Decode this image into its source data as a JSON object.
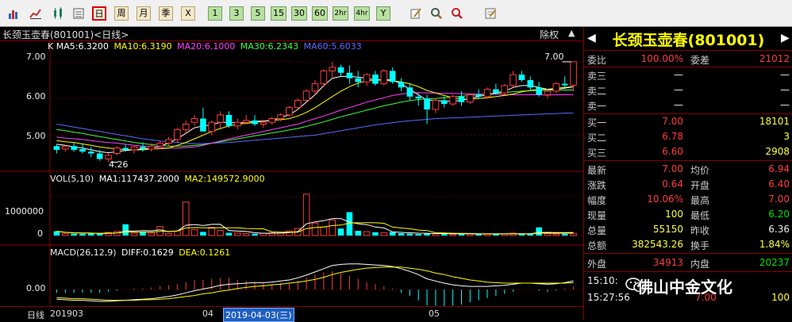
{
  "toolbar": {
    "icons": [
      "bar-chart-icon",
      "line-chart-icon",
      "kline-icon",
      "candlestick-icon",
      "quote-list-icon"
    ],
    "periods": [
      "日",
      "周",
      "月",
      "季",
      "X"
    ],
    "minutes": [
      "1",
      "3",
      "5",
      "15",
      "30",
      "60",
      "2hr",
      "4hr",
      "Y"
    ],
    "tools": [
      "edit-icon",
      "search-icon",
      "search-red-icon",
      "notes-icon"
    ]
  },
  "title": {
    "stock": "长颈玉壶春(801001)<日线>",
    "fuquan": "除权"
  },
  "legends": {
    "k_prefix": "K",
    "ma5": "MA5:6.3200",
    "ma10": "MA10:6.3190",
    "ma20": "MA20:6.1000",
    "ma30": "MA30:6.2343",
    "ma60": "MA60:5.6033",
    "vol": "VOL(5,10)",
    "vol_ma1": "MA1:117437.2000",
    "vol_ma2": "MA2:149572.9000",
    "macd": "MACD(26,12,9)",
    "diff": "DIFF:0.1629",
    "dea": "DEA:0.1261"
  },
  "axis": {
    "price_ticks": [
      "7.00",
      "6.00",
      "5.00"
    ],
    "vol_ticks": [
      "1000000",
      "0"
    ],
    "macd_ticks": [
      "0.00"
    ],
    "high_label": "7.00",
    "low_label": "4.26"
  },
  "date_bar": {
    "label": "日线",
    "start": "201903",
    "m04": "04",
    "selected": "2019-04-03(三)",
    "m05": "05"
  },
  "panel": {
    "title": "长颈玉壶春(801001)",
    "weibi_label": "委比",
    "weibi": "100.00%",
    "weicha_label": "委差",
    "weicha": "21012",
    "sell": [
      {
        "label": "卖三",
        "price": "—",
        "vol": "—"
      },
      {
        "label": "卖二",
        "price": "—",
        "vol": "—"
      },
      {
        "label": "卖一",
        "price": "—",
        "vol": "—"
      }
    ],
    "buy": [
      {
        "label": "买一",
        "price": "7.00",
        "vol": "18101"
      },
      {
        "label": "买二",
        "price": "6.78",
        "vol": "3"
      },
      {
        "label": "买三",
        "price": "6.60",
        "vol": "2908"
      }
    ],
    "stats": [
      {
        "l1": "最新",
        "v1": "7.00",
        "l2": "均价",
        "v2": "6.94"
      },
      {
        "l1": "涨跌",
        "v1": "0.64",
        "l2": "开盘",
        "v2": "6.40"
      },
      {
        "l1": "幅度",
        "v1": "10.06%",
        "l2": "最高",
        "v2": "7.00"
      },
      {
        "l1": "现量",
        "v1": "100",
        "l2": "最低",
        "v2": "6.20"
      },
      {
        "l1": "总量",
        "v1": "55150",
        "l2": "昨收",
        "v2": "6.36"
      },
      {
        "l1": "总额",
        "v1": "382543.26",
        "l2": "换手",
        "v2": "1.84%"
      }
    ],
    "waipan_label": "外盘",
    "waipan": "34913",
    "neipan_label": "内盘",
    "neipan": "20237",
    "ticks": [
      {
        "time": "15:10:",
        "price": "",
        "vol": ""
      },
      {
        "time": "15:27:56",
        "price": "7.00",
        "vol": "100"
      }
    ]
  },
  "watermark": "佛山中金文化",
  "colors": {
    "up": "#ff3c3c",
    "down": "#00ffff",
    "ma5": "#ffffff",
    "ma10": "#ffff00",
    "ma20": "#ff40ff",
    "ma30": "#40ff40",
    "ma60": "#5a6aff"
  },
  "chart_data": {
    "type": "candlestick",
    "ohlc": [
      [
        4.7,
        4.75,
        4.5,
        4.6
      ],
      [
        4.62,
        4.72,
        4.55,
        4.7
      ],
      [
        4.7,
        4.8,
        4.55,
        4.6
      ],
      [
        4.62,
        4.78,
        4.5,
        4.55
      ],
      [
        4.55,
        4.68,
        4.4,
        4.5
      ],
      [
        4.5,
        4.6,
        4.3,
        4.35
      ],
      [
        4.35,
        4.5,
        4.26,
        4.45
      ],
      [
        4.5,
        4.7,
        4.45,
        4.65
      ],
      [
        4.65,
        4.75,
        4.55,
        4.6
      ],
      [
        4.6,
        4.72,
        4.5,
        4.68
      ],
      [
        4.68,
        4.8,
        4.55,
        4.62
      ],
      [
        4.62,
        4.78,
        4.55,
        4.7
      ],
      [
        4.7,
        4.85,
        4.62,
        4.78
      ],
      [
        4.78,
        4.95,
        4.7,
        4.88
      ],
      [
        4.88,
        5.2,
        4.8,
        5.15
      ],
      [
        5.15,
        5.4,
        5.05,
        5.3
      ],
      [
        5.35,
        5.55,
        5.25,
        5.45
      ],
      [
        5.45,
        5.75,
        5.4,
        5.1
      ],
      [
        5.1,
        5.4,
        5.0,
        5.35
      ],
      [
        5.35,
        5.65,
        5.2,
        5.55
      ],
      [
        5.55,
        5.65,
        5.2,
        5.25
      ],
      [
        5.25,
        5.45,
        5.15,
        5.35
      ],
      [
        5.35,
        5.55,
        5.3,
        5.4
      ],
      [
        5.4,
        5.55,
        5.25,
        5.3
      ],
      [
        5.3,
        5.42,
        5.2,
        5.35
      ],
      [
        5.35,
        5.5,
        5.28,
        5.45
      ],
      [
        5.45,
        5.6,
        5.38,
        5.55
      ],
      [
        5.55,
        5.8,
        5.5,
        5.75
      ],
      [
        5.75,
        6.0,
        5.7,
        5.95
      ],
      [
        5.95,
        6.25,
        5.9,
        6.2
      ],
      [
        6.2,
        6.5,
        6.1,
        6.4
      ],
      [
        6.4,
        6.8,
        6.3,
        6.75
      ],
      [
        6.75,
        7.0,
        6.55,
        6.85
      ],
      [
        6.85,
        6.92,
        6.6,
        6.7
      ],
      [
        6.7,
        6.9,
        6.4,
        6.55
      ],
      [
        6.55,
        6.75,
        6.3,
        6.45
      ],
      [
        6.45,
        6.7,
        6.35,
        6.65
      ],
      [
        6.65,
        6.75,
        6.35,
        6.4
      ],
      [
        6.4,
        6.8,
        6.35,
        6.75
      ],
      [
        6.75,
        6.85,
        6.4,
        6.45
      ],
      [
        6.45,
        6.55,
        6.2,
        6.3
      ],
      [
        6.3,
        6.4,
        5.95,
        6.05
      ],
      [
        6.05,
        6.15,
        5.8,
        6.0
      ],
      [
        6.0,
        6.1,
        5.3,
        5.7
      ],
      [
        5.7,
        6.0,
        5.6,
        5.95
      ],
      [
        5.95,
        6.05,
        5.75,
        5.85
      ],
      [
        5.85,
        6.1,
        5.8,
        6.05
      ],
      [
        6.05,
        6.2,
        5.8,
        5.9
      ],
      [
        5.9,
        6.15,
        5.85,
        6.1
      ],
      [
        6.1,
        6.25,
        6.0,
        6.05
      ],
      [
        6.05,
        6.3,
        6.0,
        6.25
      ],
      [
        6.25,
        6.4,
        6.1,
        6.15
      ],
      [
        6.15,
        6.4,
        6.1,
        6.35
      ],
      [
        6.35,
        6.75,
        6.3,
        6.65
      ],
      [
        6.65,
        6.75,
        6.45,
        6.5
      ],
      [
        6.5,
        6.6,
        6.2,
        6.3
      ],
      [
        6.3,
        6.45,
        6.05,
        6.1
      ],
      [
        6.1,
        6.25,
        6.0,
        6.2
      ],
      [
        6.2,
        6.45,
        6.15,
        6.4
      ],
      [
        6.4,
        6.6,
        6.3,
        6.36
      ],
      [
        6.36,
        7.0,
        6.2,
        7.0
      ]
    ],
    "volume": [
      110000,
      55000,
      50000,
      45000,
      60000,
      40000,
      80000,
      105000,
      290000,
      60000,
      100000,
      60000,
      230000,
      55000,
      120000,
      860000,
      150000,
      95000,
      210000,
      130000,
      70000,
      65000,
      50000,
      45000,
      60000,
      70000,
      80000,
      120000,
      180000,
      1060000,
      320000,
      220000,
      400000,
      180000,
      600000,
      120000,
      100000,
      85000,
      70000,
      90000,
      60000,
      50000,
      40000,
      60000,
      45000,
      55000,
      35000,
      50000,
      40000,
      35000,
      45000,
      40000,
      45000,
      60000,
      45000,
      40000,
      210000,
      50000,
      40000,
      45000,
      55150
    ],
    "ma5": [
      4.75,
      4.72,
      4.68,
      4.65,
      4.6,
      4.55,
      4.52,
      4.55,
      4.58,
      4.6,
      4.62,
      4.65,
      4.7,
      4.78,
      4.9,
      5.05,
      5.2,
      5.25,
      5.28,
      5.35,
      5.35,
      5.33,
      5.35,
      5.38,
      5.38,
      5.4,
      5.48,
      5.55,
      5.7,
      5.9,
      6.1,
      6.35,
      6.55,
      6.6,
      6.6,
      6.58,
      6.55,
      6.5,
      6.52,
      6.5,
      6.4,
      6.25,
      6.1,
      5.95,
      5.95,
      5.92,
      5.92,
      5.95,
      6.0,
      6.05,
      6.1,
      6.15,
      6.2,
      6.3,
      6.35,
      6.35,
      6.3,
      6.25,
      6.25,
      6.28,
      6.32
    ],
    "ma10": [
      4.85,
      4.82,
      4.8,
      4.76,
      4.72,
      4.68,
      4.65,
      4.62,
      4.6,
      4.6,
      4.6,
      4.62,
      4.63,
      4.65,
      4.72,
      4.8,
      4.9,
      5.0,
      5.1,
      5.18,
      5.25,
      5.3,
      5.32,
      5.35,
      5.38,
      5.4,
      5.42,
      5.45,
      5.52,
      5.62,
      5.75,
      5.9,
      6.05,
      6.2,
      6.32,
      6.42,
      6.48,
      6.5,
      6.5,
      6.48,
      6.45,
      6.4,
      6.32,
      6.22,
      6.15,
      6.08,
      6.02,
      5.98,
      5.98,
      6.0,
      6.02,
      6.05,
      6.08,
      6.12,
      6.18,
      6.22,
      6.25,
      6.25,
      6.28,
      6.3,
      6.32
    ],
    "ma20": [
      4.95,
      4.92,
      4.9,
      4.88,
      4.85,
      4.82,
      4.8,
      4.78,
      4.75,
      4.72,
      4.7,
      4.68,
      4.66,
      4.65,
      4.65,
      4.66,
      4.68,
      4.72,
      4.78,
      4.84,
      4.9,
      4.95,
      5.0,
      5.05,
      5.1,
      5.15,
      5.2,
      5.25,
      5.3,
      5.38,
      5.45,
      5.52,
      5.6,
      5.68,
      5.75,
      5.82,
      5.9,
      5.96,
      6.02,
      6.08,
      6.12,
      6.15,
      6.16,
      6.15,
      6.15,
      6.14,
      6.14,
      6.13,
      6.12,
      6.12,
      6.12,
      6.12,
      6.1,
      6.1,
      6.1,
      6.1,
      6.1,
      6.09,
      6.1,
      6.1,
      6.1
    ],
    "ma30": [
      5.15,
      5.12,
      5.08,
      5.05,
      5.0,
      4.96,
      4.92,
      4.88,
      4.84,
      4.8,
      4.77,
      4.74,
      4.72,
      4.7,
      4.7,
      4.7,
      4.72,
      4.74,
      4.78,
      4.82,
      4.86,
      4.9,
      4.94,
      4.98,
      5.02,
      5.06,
      5.1,
      5.14,
      5.18,
      5.24,
      5.3,
      5.36,
      5.43,
      5.5,
      5.56,
      5.62,
      5.68,
      5.74,
      5.8,
      5.85,
      5.9,
      5.94,
      5.97,
      5.99,
      6.0,
      6.02,
      6.04,
      6.06,
      6.08,
      6.1,
      6.12,
      6.14,
      6.16,
      6.18,
      6.2,
      6.21,
      6.22,
      6.22,
      6.23,
      6.23,
      6.23
    ],
    "ma60": [
      5.3,
      5.26,
      5.22,
      5.18,
      5.14,
      5.1,
      5.06,
      5.02,
      4.98,
      4.94,
      4.9,
      4.87,
      4.84,
      4.82,
      4.8,
      4.78,
      4.77,
      4.77,
      4.78,
      4.79,
      4.8,
      4.82,
      4.84,
      4.86,
      4.88,
      4.9,
      4.92,
      4.94,
      4.96,
      4.98,
      5.0,
      5.04,
      5.08,
      5.12,
      5.16,
      5.2,
      5.24,
      5.28,
      5.31,
      5.34,
      5.37,
      5.39,
      5.41,
      5.43,
      5.45,
      5.46,
      5.47,
      5.48,
      5.49,
      5.5,
      5.51,
      5.52,
      5.53,
      5.54,
      5.55,
      5.56,
      5.57,
      5.58,
      5.59,
      5.6,
      5.6
    ],
    "diff": [
      -0.18,
      -0.19,
      -0.2,
      -0.2,
      -0.21,
      -0.22,
      -0.22,
      -0.21,
      -0.2,
      -0.19,
      -0.18,
      -0.17,
      -0.15,
      -0.13,
      -0.1,
      -0.06,
      -0.02,
      0.01,
      0.04,
      0.08,
      0.1,
      0.11,
      0.12,
      0.13,
      0.13,
      0.14,
      0.16,
      0.18,
      0.22,
      0.27,
      0.33,
      0.39,
      0.45,
      0.47,
      0.48,
      0.48,
      0.47,
      0.46,
      0.45,
      0.43,
      0.39,
      0.34,
      0.28,
      0.2,
      0.16,
      0.12,
      0.09,
      0.07,
      0.06,
      0.06,
      0.06,
      0.07,
      0.08,
      0.1,
      0.12,
      0.12,
      0.11,
      0.1,
      0.11,
      0.13,
      0.16
    ],
    "dea": [
      -0.15,
      -0.16,
      -0.17,
      -0.17,
      -0.18,
      -0.19,
      -0.2,
      -0.2,
      -0.2,
      -0.2,
      -0.19,
      -0.19,
      -0.18,
      -0.17,
      -0.15,
      -0.13,
      -0.11,
      -0.08,
      -0.06,
      -0.03,
      -0.01,
      0.02,
      0.04,
      0.06,
      0.07,
      0.09,
      0.1,
      0.12,
      0.14,
      0.16,
      0.19,
      0.23,
      0.28,
      0.32,
      0.35,
      0.38,
      0.4,
      0.41,
      0.42,
      0.42,
      0.42,
      0.4,
      0.38,
      0.35,
      0.31,
      0.28,
      0.24,
      0.21,
      0.18,
      0.16,
      0.14,
      0.13,
      0.12,
      0.12,
      0.12,
      0.12,
      0.12,
      0.12,
      0.12,
      0.12,
      0.13
    ],
    "price_range": [
      4.1,
      7.3
    ],
    "volume_range": [
      0,
      1200000
    ],
    "macd_range": [
      -0.25,
      0.55
    ],
    "low_index": 6,
    "high_index": 60
  }
}
